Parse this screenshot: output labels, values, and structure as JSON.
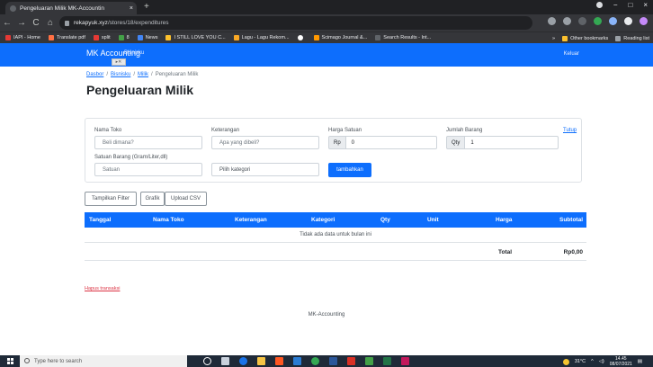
{
  "browser": {
    "tab_title": "Pengeluaran Milik MK-Accountin",
    "tab_close": "×",
    "new_tab": "+",
    "url_host": "rekapyuk.xyz",
    "url_path": "/stores/18/expenditures",
    "back": "←",
    "forward": "→",
    "reload": "C",
    "home": "⌂",
    "window_controls": [
      "−",
      "□",
      "×"
    ],
    "bookmarks": [
      {
        "label": "IAPI - Home",
        "color": "#e53935"
      },
      {
        "label": "Translate pdf",
        "color": "#ff7043"
      },
      {
        "label": "split",
        "color": "#e53935"
      },
      {
        "label": "8",
        "color": "#43a047"
      },
      {
        "label": "News",
        "color": "#4285f4"
      },
      {
        "label": "I STILL LOVE YOU C...",
        "color": "#fbc02d"
      },
      {
        "label": "Lagu - Lagu Rekom...",
        "color": "#f9a825"
      },
      {
        "label": "",
        "color": "#ffffff"
      },
      {
        "label": "Scimago Journal &...",
        "color": "#ff9800"
      },
      {
        "label": "Search Results - Int...",
        "color": "#5f6368"
      }
    ],
    "bookmarks_overflow": "»",
    "other_bookmarks": "Other bookmarks",
    "reading_list": "Reading list"
  },
  "navbar": {
    "brand": "MK Accounting",
    "brand_sub": "Bisnisku",
    "logout": "Keluar"
  },
  "breadcrumb": {
    "items": [
      "Dasbor",
      "Bisnisku",
      "Milik"
    ],
    "current": "Pengeluaran Milik",
    "separator": "/"
  },
  "page_title": "Pengeluaran Milik",
  "form": {
    "store_name_label": "Nama Toko",
    "store_name_placeholder": "Beli dimana?",
    "description_label": "Keterangan",
    "description_placeholder": "Apa yang dibeli?",
    "unit_price_label": "Harga Satuan",
    "unit_price_prefix": "Rp",
    "unit_price_value": "0",
    "quantity_label": "Jumlah Barang",
    "quantity_prefix": "Qty",
    "quantity_value": "1",
    "close_link": "Tutup",
    "unit_label": "Satuan Barang (Gram/Liter,dll)",
    "unit_placeholder": "Satuan",
    "category_placeholder": "Pilih kategori",
    "add_button": "tambahkan"
  },
  "toolbar": {
    "filter_button": "Tampilkan Filter",
    "chart_button": "Grafik",
    "upload_button": "Upload CSV"
  },
  "table": {
    "headers": [
      "Tanggal",
      "Nama Toko",
      "Keterangan",
      "Kategori",
      "Qty",
      "Unit",
      "Harga",
      "Subtotal"
    ],
    "empty_message": "Tidak ada data untuk bulan ini",
    "total_label": "Total",
    "total_value": "Rp0,00"
  },
  "delete_link": "Hapus transaksi",
  "footer": "MK-Accounting",
  "taskbar": {
    "search_placeholder": "Type here to search",
    "weather": "31°C",
    "time": "14.45",
    "date": "08/07/2021"
  },
  "colors": {
    "primary": "#0d6efd",
    "danger": "#dc3545"
  }
}
